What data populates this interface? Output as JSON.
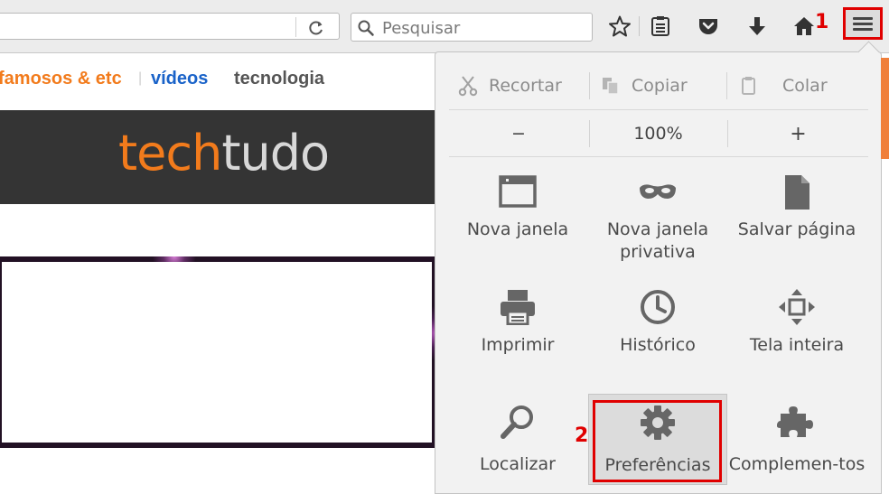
{
  "toolbar": {
    "search_placeholder": "Pesquisar",
    "annotation_1": "1",
    "icons": [
      "star-icon",
      "reading-list-icon",
      "pocket-icon",
      "download-icon",
      "home-icon",
      "hamburger-menu-icon"
    ]
  },
  "site": {
    "nav": [
      "famosos & etc",
      "vídeos",
      "tecnologia"
    ],
    "logo_part1": "tech",
    "logo_part2": "tudo",
    "colors": {
      "nav1": "#f27b1c",
      "nav2": "#1a63c9",
      "nav3": "#555555",
      "banner": "#343434"
    }
  },
  "menu": {
    "edit": {
      "cut": "Recortar",
      "copy": "Copiar",
      "paste": "Colar"
    },
    "zoom": {
      "minus": "−",
      "level": "100%",
      "plus": "+"
    },
    "items": [
      {
        "label": "Nova janela",
        "icon": "new-window-icon"
      },
      {
        "label": "Nova janela privativa",
        "icon": "private-mask-icon"
      },
      {
        "label": "Salvar página",
        "icon": "save-page-icon"
      },
      {
        "label": "Imprimir",
        "icon": "print-icon"
      },
      {
        "label": "Histórico",
        "icon": "history-clock-icon"
      },
      {
        "label": "Tela inteira",
        "icon": "fullscreen-icon"
      },
      {
        "label": "Localizar",
        "icon": "find-magnifier-icon"
      },
      {
        "label": "Preferências",
        "icon": "gear-icon"
      },
      {
        "label": "Complemen-tos",
        "icon": "puzzle-icon"
      }
    ],
    "annotation_2": "2",
    "accent": "#e00000"
  }
}
